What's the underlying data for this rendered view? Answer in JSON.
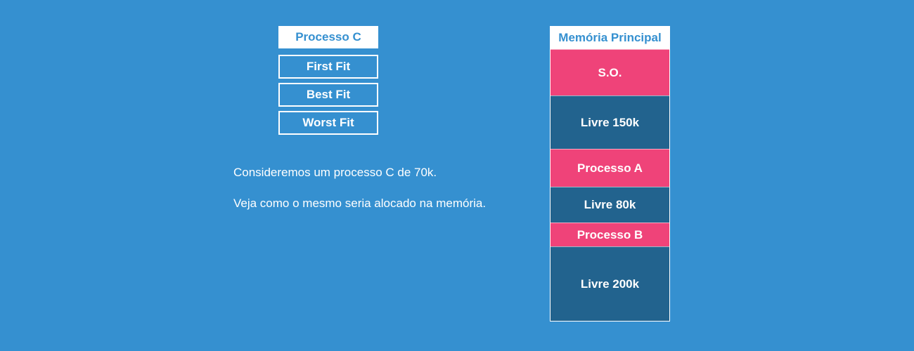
{
  "process": {
    "title": "Processo C",
    "algorithms": [
      "First Fit",
      "Best Fit",
      "Worst Fit"
    ]
  },
  "description": [
    "Consideremos um processo C de 70k.",
    "Veja como o mesmo seria alocado na memória."
  ],
  "memory": {
    "title": "Memória Principal",
    "blocks": [
      {
        "label": "S.O.",
        "kind": "occupied"
      },
      {
        "label": "Livre 150k",
        "kind": "free"
      },
      {
        "label": "Processo A",
        "kind": "occupied"
      },
      {
        "label": "Livre 80k",
        "kind": "free"
      },
      {
        "label": "Processo B",
        "kind": "occupied"
      },
      {
        "label": "Livre 200k",
        "kind": "free"
      }
    ]
  },
  "colors": {
    "background": "#3590d0",
    "occupied": "#ef4379",
    "free": "#22638e",
    "header_bg": "#ffffff",
    "header_text": "#3590d0"
  }
}
